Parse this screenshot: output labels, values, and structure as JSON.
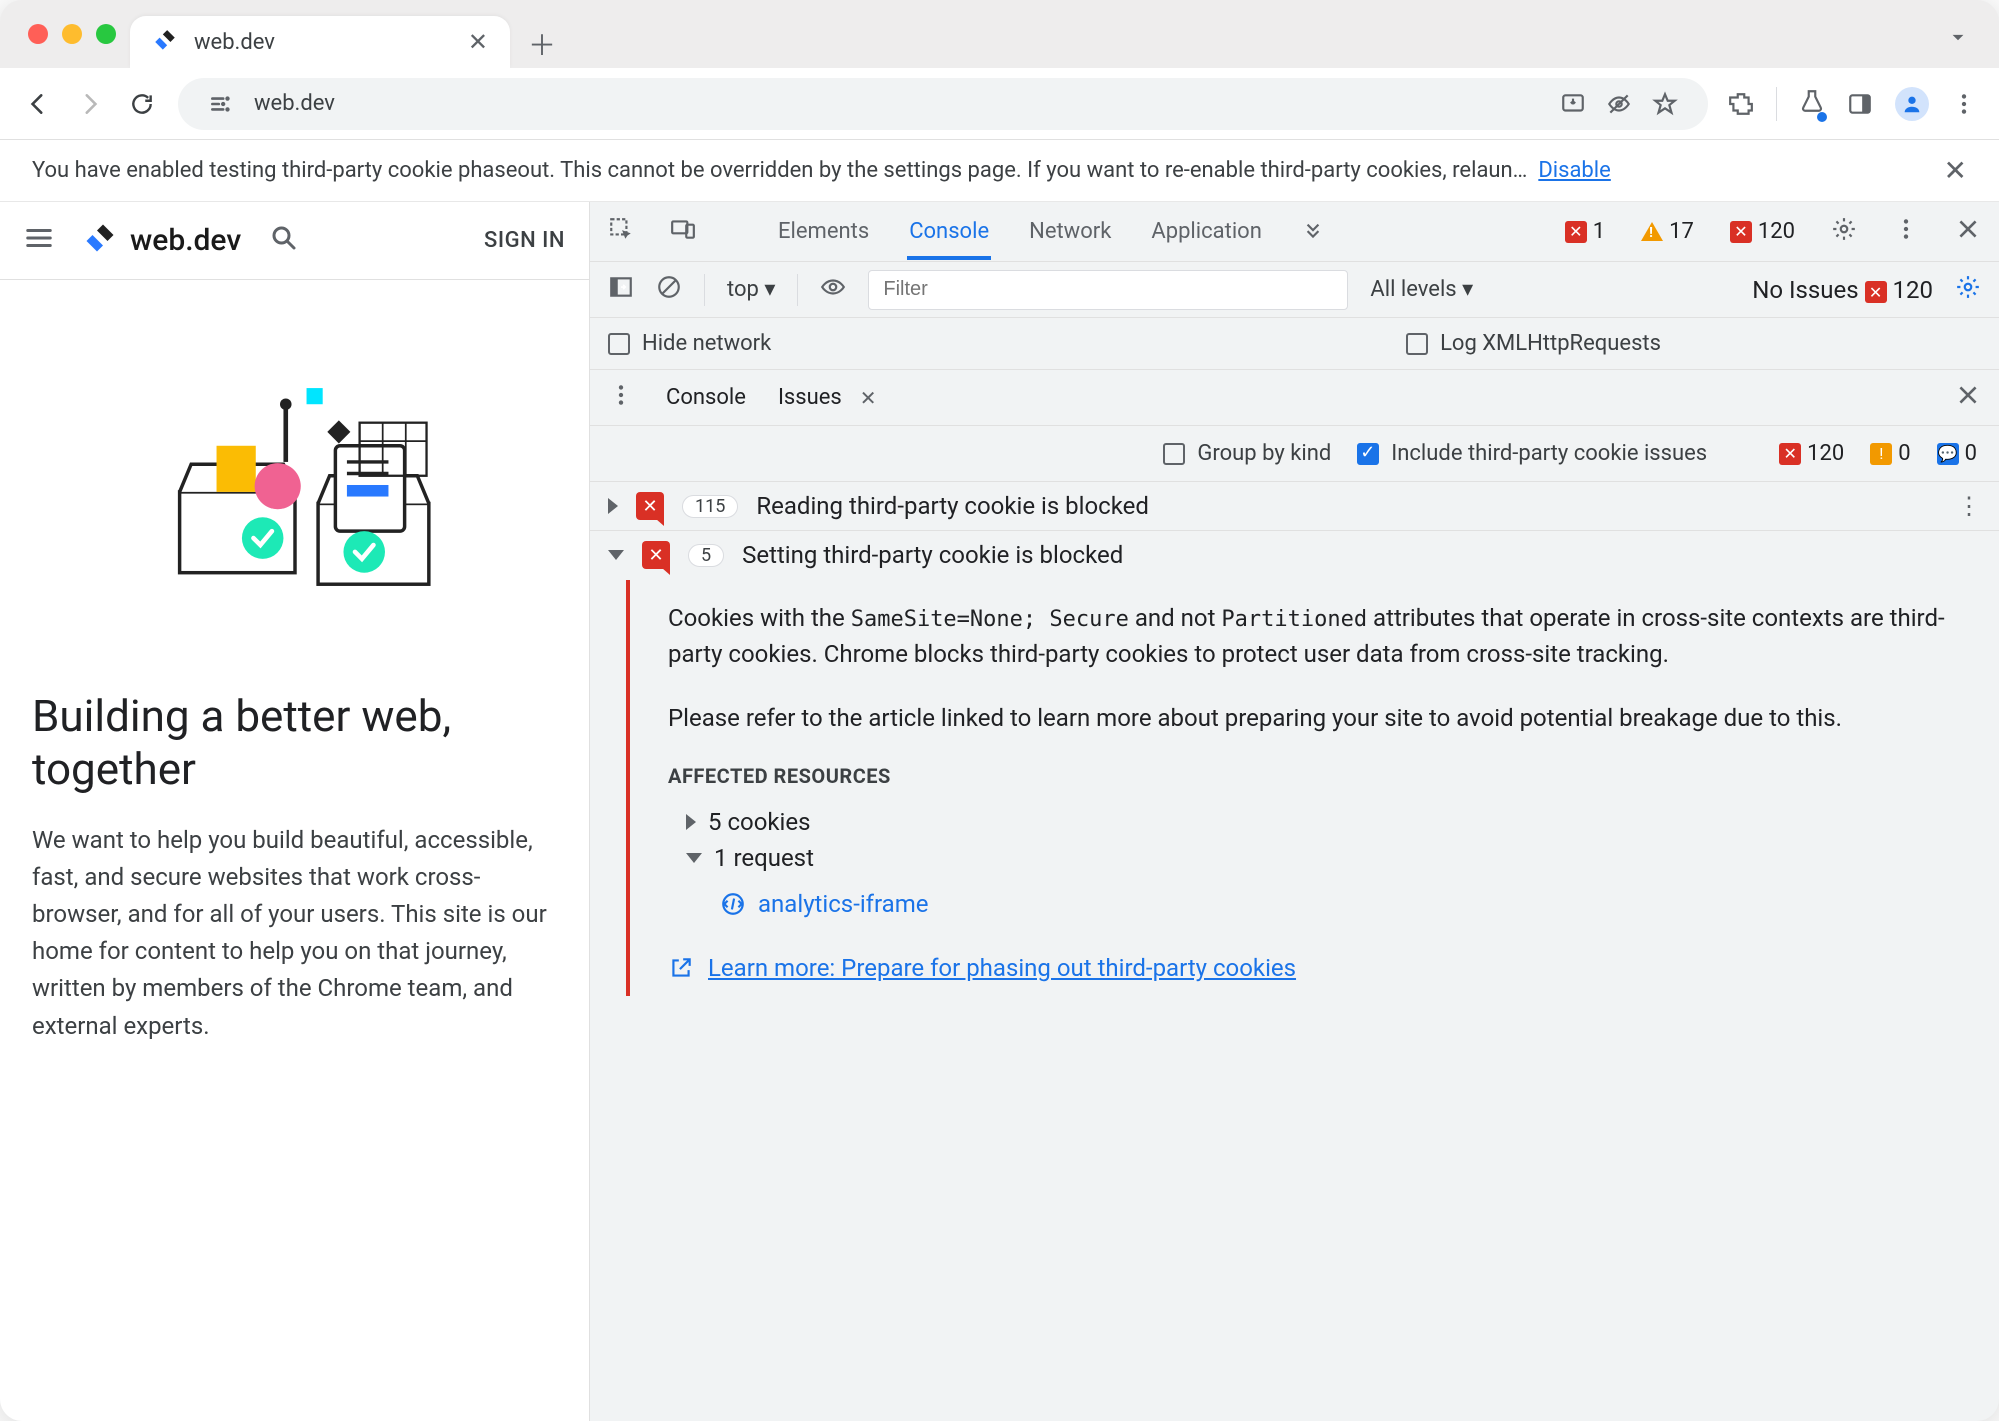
{
  "browser": {
    "tab_title": "web.dev",
    "url": "web.dev"
  },
  "infobar": {
    "text": "You have enabled testing third-party cookie phaseout. This cannot be overridden by the settings page. If you want to re-enable third-party cookies, relaun…",
    "action": "Disable"
  },
  "page": {
    "signin": "SIGN IN",
    "brand": "web.dev",
    "headline": "Building a better web, together",
    "body": "We want to help you build beautiful, accessible, fast, and secure websites that work cross-browser, and for all of your users. This site is our home for content to help you on that journey, written by members of the Chrome team, and external experts."
  },
  "devtools": {
    "tabs": [
      "Elements",
      "Console",
      "Network",
      "Application"
    ],
    "active_tab": "Console",
    "counts": {
      "errors": 1,
      "warnings": 17,
      "messages": 120
    },
    "console_toolbar": {
      "context": "top",
      "filter_placeholder": "Filter",
      "levels": "All levels",
      "no_issues": "No Issues",
      "no_issues_count": 120
    },
    "settings": {
      "hide_network": "Hide network",
      "log_xhr": "Log XMLHttpRequests"
    },
    "drawer": {
      "tabs": [
        "Console",
        "Issues"
      ],
      "active": "Issues"
    },
    "issues_toolbar": {
      "group_by_kind": "Group by kind",
      "include_3p": "Include third-party cookie issues",
      "count_red": 120,
      "count_orange": 0,
      "count_blue": 0
    },
    "issues": [
      {
        "count": 115,
        "title": "Reading third-party cookie is blocked",
        "expanded": false
      },
      {
        "count": 5,
        "title": "Setting third-party cookie is blocked",
        "expanded": true
      }
    ],
    "detail": {
      "p1_a": "Cookies with the ",
      "p1_code1": "SameSite=None; Secure",
      "p1_b": " and not ",
      "p1_code2": "Partitioned",
      "p1_c": " attributes that operate in cross-site contexts are third-party cookies. Chrome blocks third-party cookies to protect user data from cross-site tracking.",
      "p2": "Please refer to the article linked to learn more about preparing your site to avoid potential breakage due to this.",
      "aff_heading": "AFFECTED RESOURCES",
      "aff_cookies": "5 cookies",
      "aff_requests": "1 request",
      "aff_resource": "analytics-iframe",
      "learn_more": "Learn more: Prepare for phasing out third-party cookies"
    }
  }
}
